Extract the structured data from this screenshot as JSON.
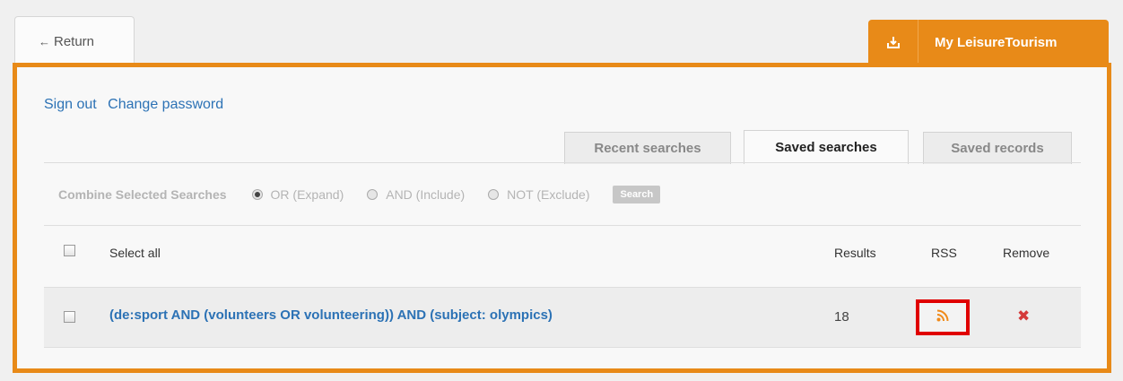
{
  "nav": {
    "return_arrow": "←",
    "return_label": "Return",
    "my_account_label": "My LeisureTourism",
    "my_account_icon": "download-icon"
  },
  "account": {
    "sign_out": "Sign out",
    "change_password": "Change password"
  },
  "tabs": [
    {
      "label": "Recent searches",
      "active": false
    },
    {
      "label": "Saved searches",
      "active": true
    },
    {
      "label": "Saved records",
      "active": false
    }
  ],
  "combine": {
    "title": "Combine Selected Searches",
    "options": [
      {
        "label": "OR (Expand)",
        "selected": true
      },
      {
        "label": "AND (Include)",
        "selected": false
      },
      {
        "label": "NOT (Exclude)",
        "selected": false
      }
    ],
    "button_label": "Search"
  },
  "table": {
    "select_all": "Select all",
    "col_results": "Results",
    "col_rss": "RSS",
    "col_remove": "Remove",
    "rows": [
      {
        "query": "(de:sport AND (volunteers OR volunteering)) AND (subject: olympics)",
        "results": "18",
        "rss_icon": "rss-feed-icon",
        "remove_icon": "close-icon",
        "remove_glyph": "✖"
      }
    ]
  },
  "colors": {
    "accent": "#e88a18",
    "link": "#2c72b5",
    "highlight": "#e00000",
    "remove": "#d43a3a"
  }
}
